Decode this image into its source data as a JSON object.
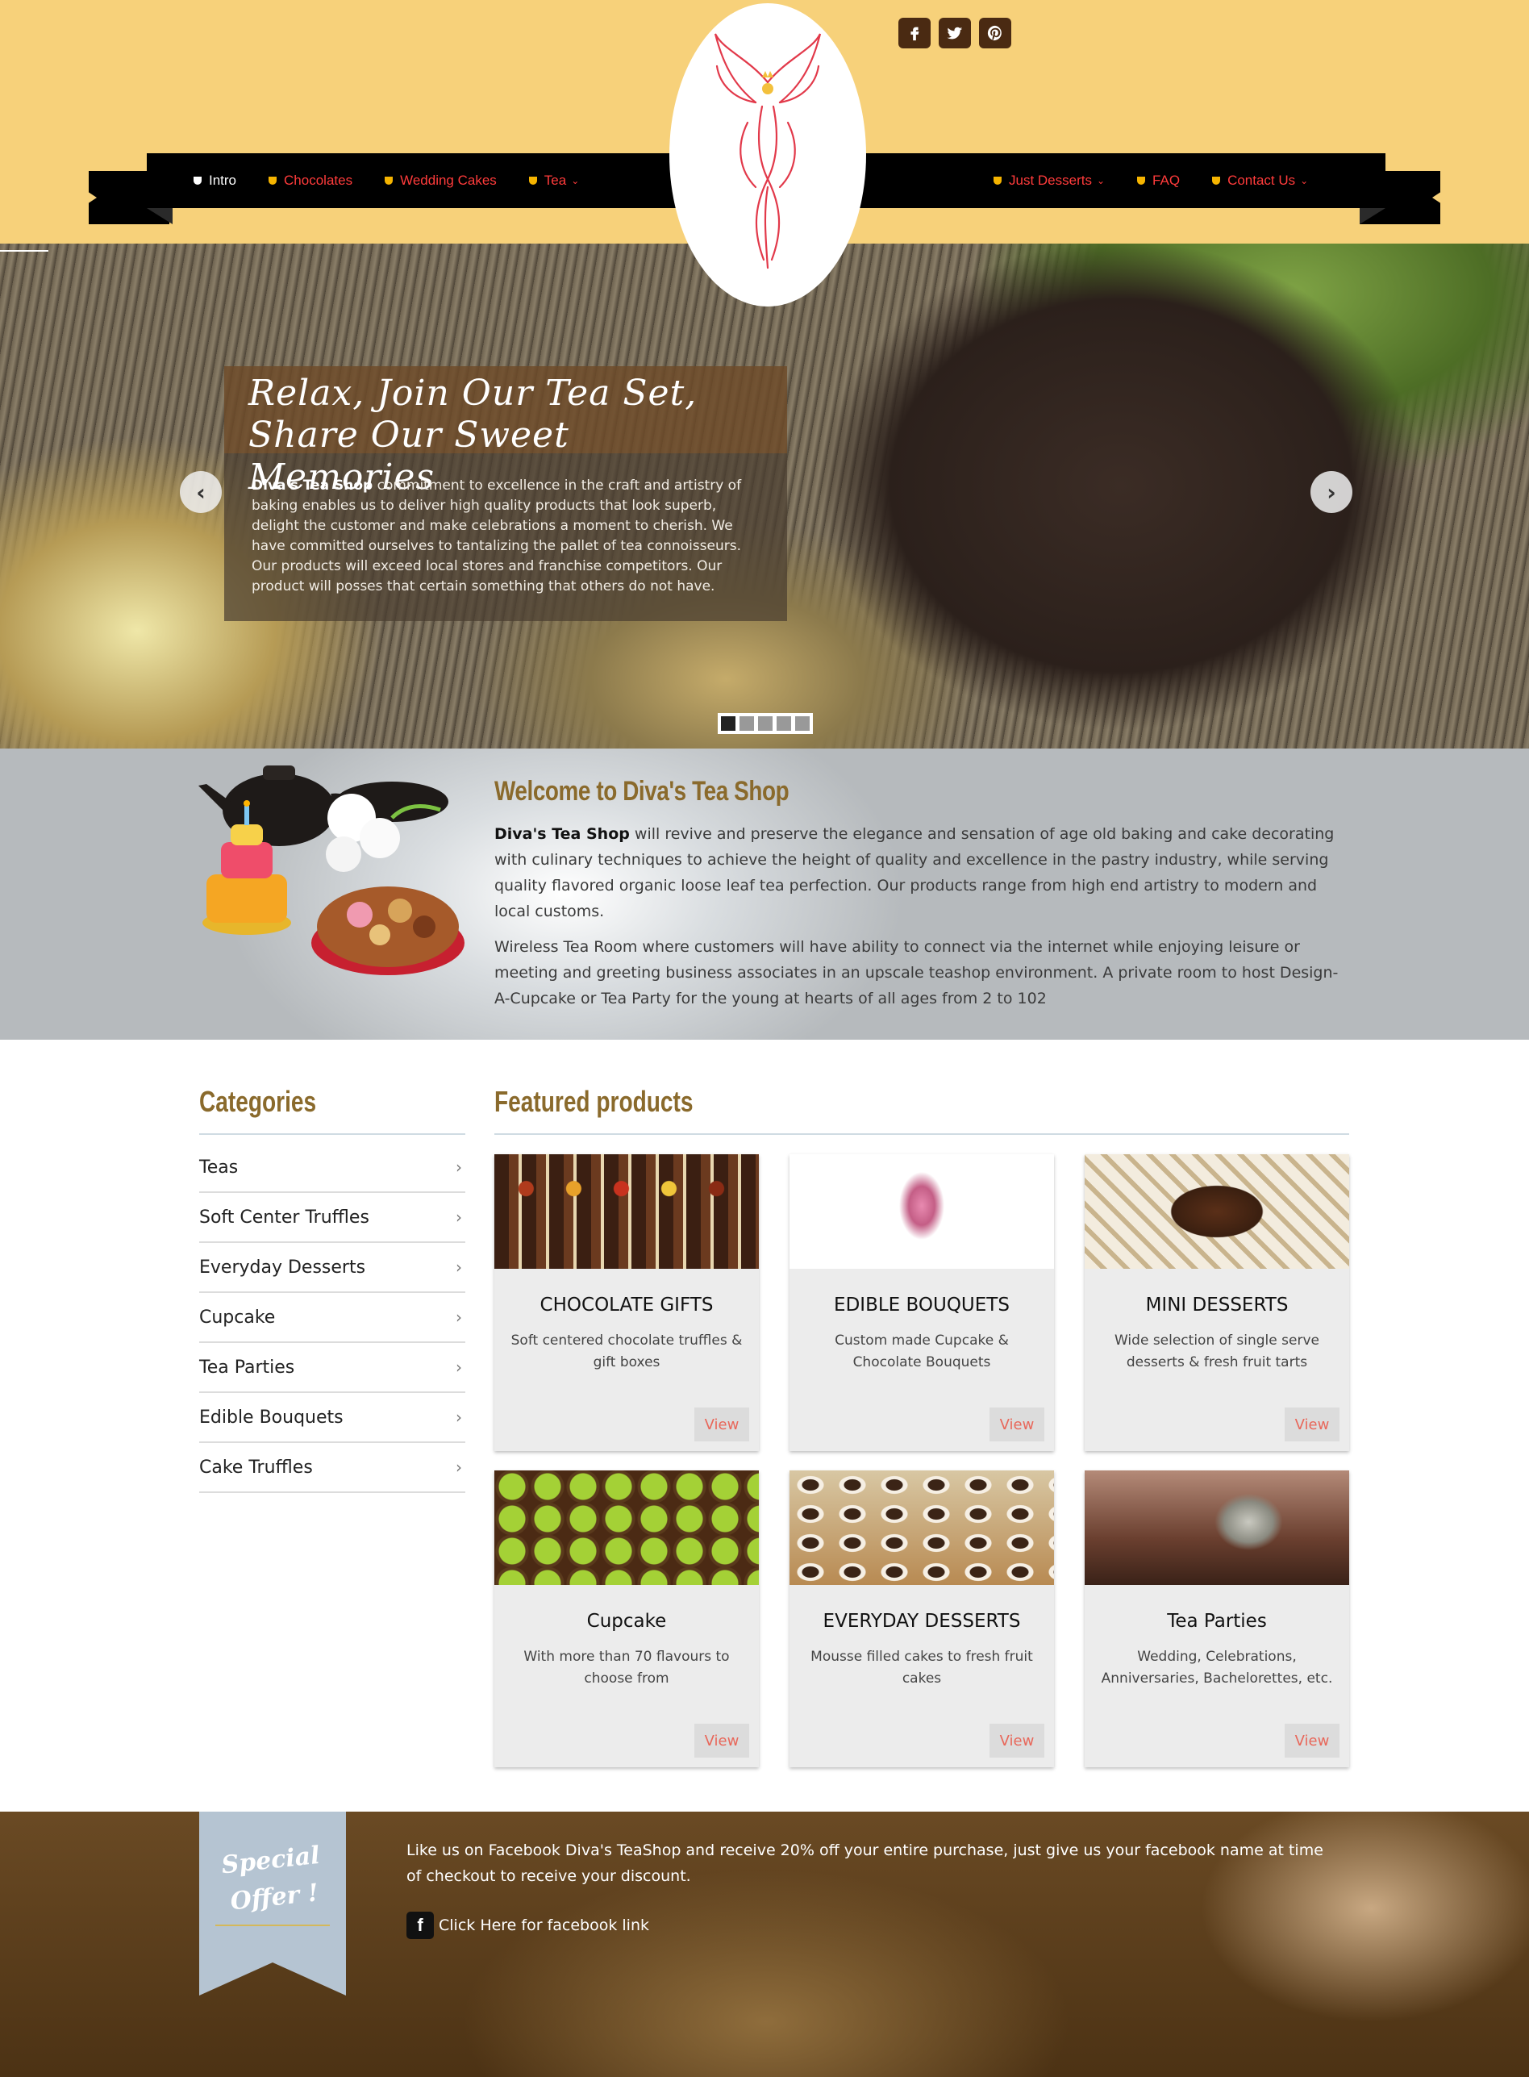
{
  "header": {
    "social": [
      {
        "name": "facebook-icon",
        "glyph": "f"
      },
      {
        "name": "twitter-icon",
        "glyph": "t"
      },
      {
        "name": "pinterest-icon",
        "glyph": "p"
      }
    ],
    "nav_left": [
      {
        "label": "Intro",
        "active": true
      },
      {
        "label": "Chocolates"
      },
      {
        "label": "Wedding Cakes"
      },
      {
        "label": "Tea",
        "dropdown": true
      }
    ],
    "nav_right": [
      {
        "label": "Just Desserts",
        "dropdown": true
      },
      {
        "label": "FAQ"
      },
      {
        "label": "Contact Us",
        "dropdown": true
      }
    ],
    "colors": {
      "header_bg": "#f7d17a",
      "nav_bg": "#000000",
      "nav_link": "#ff3b3b",
      "nav_active": "#ffffff"
    }
  },
  "hero": {
    "title": "Relax, Join Our Tea Set, Share Our Sweet Memories",
    "brand": "Diva's Tea Shop",
    "text": " commitment to excellence in the craft and artistry of baking enables us to deliver high quality products that look superb, delight the customer and make celebrations a moment to cherish. We have committed ourselves to tantalizing the pallet of tea connoisseurs. Our products will exceed local stores and franchise competitors. Our product will posses that certain something that others do not have.",
    "prev_icon": "chevron-left-icon",
    "next_icon": "chevron-right-icon",
    "slide_count": 5,
    "active_slide": 1
  },
  "welcome": {
    "title": "Welcome to Diva's Tea Shop",
    "brand": "Diva's Tea Shop",
    "p1": " will revive and preserve the elegance and sensation of age old baking and cake decorating with culinary techniques to achieve the height of quality and excellence in the pastry industry, while serving quality flavored organic loose leaf tea perfection. Our products range from high end artistry to modern and local customs.",
    "p2": "Wireless Tea Room where customers will have ability to connect via the internet while enjoying leisure or meeting and greeting business associates in an upscale teashop environment. A private room to host Design-A-Cupcake or Tea Party for the young at hearts of all ages from 2 to 102"
  },
  "categories": {
    "title": "Categories",
    "items": [
      "Teas",
      "Soft Center Truffles",
      "Everyday Desserts",
      "Cupcake",
      "Tea Parties",
      "Edible Bouquets",
      "Cake Truffles"
    ]
  },
  "featured": {
    "title": "Featured products",
    "products": [
      {
        "title": "CHOCOLATE GIFTS",
        "desc": "Soft centered chocolate truffles & gift boxes",
        "button": "View",
        "img": "img-choc"
      },
      {
        "title": "EDIBLE BOUQUETS",
        "desc": "Custom made Cupcake & Chocolate Bouquets",
        "button": "View",
        "img": "img-bouquet"
      },
      {
        "title": "MINI DESSERTS",
        "desc": "Wide selection of single serve desserts & fresh fruit tarts",
        "button": "View",
        "img": "img-mini"
      },
      {
        "title": "Cupcake",
        "desc": "With more than 70 flavours to choose from",
        "button": "View",
        "img": "img-cupcake"
      },
      {
        "title": "EVERYDAY DESSERTS",
        "desc": "Mousse filled cakes to fresh fruit cakes",
        "button": "View",
        "img": "img-everyday"
      },
      {
        "title": "Tea Parties",
        "desc": "Wedding, Celebrations, Anniversaries, Bachelorettes, etc.",
        "button": "View",
        "img": "img-parties"
      }
    ]
  },
  "footer": {
    "badge_line1": "Special",
    "badge_line2": "Offer !",
    "text": "Like us on Facebook Diva's TeaShop and receive 20% off your entire purchase, just give us your facebook name at time of checkout to receive your discount.",
    "fb_label": "Click Here for facebook link"
  }
}
